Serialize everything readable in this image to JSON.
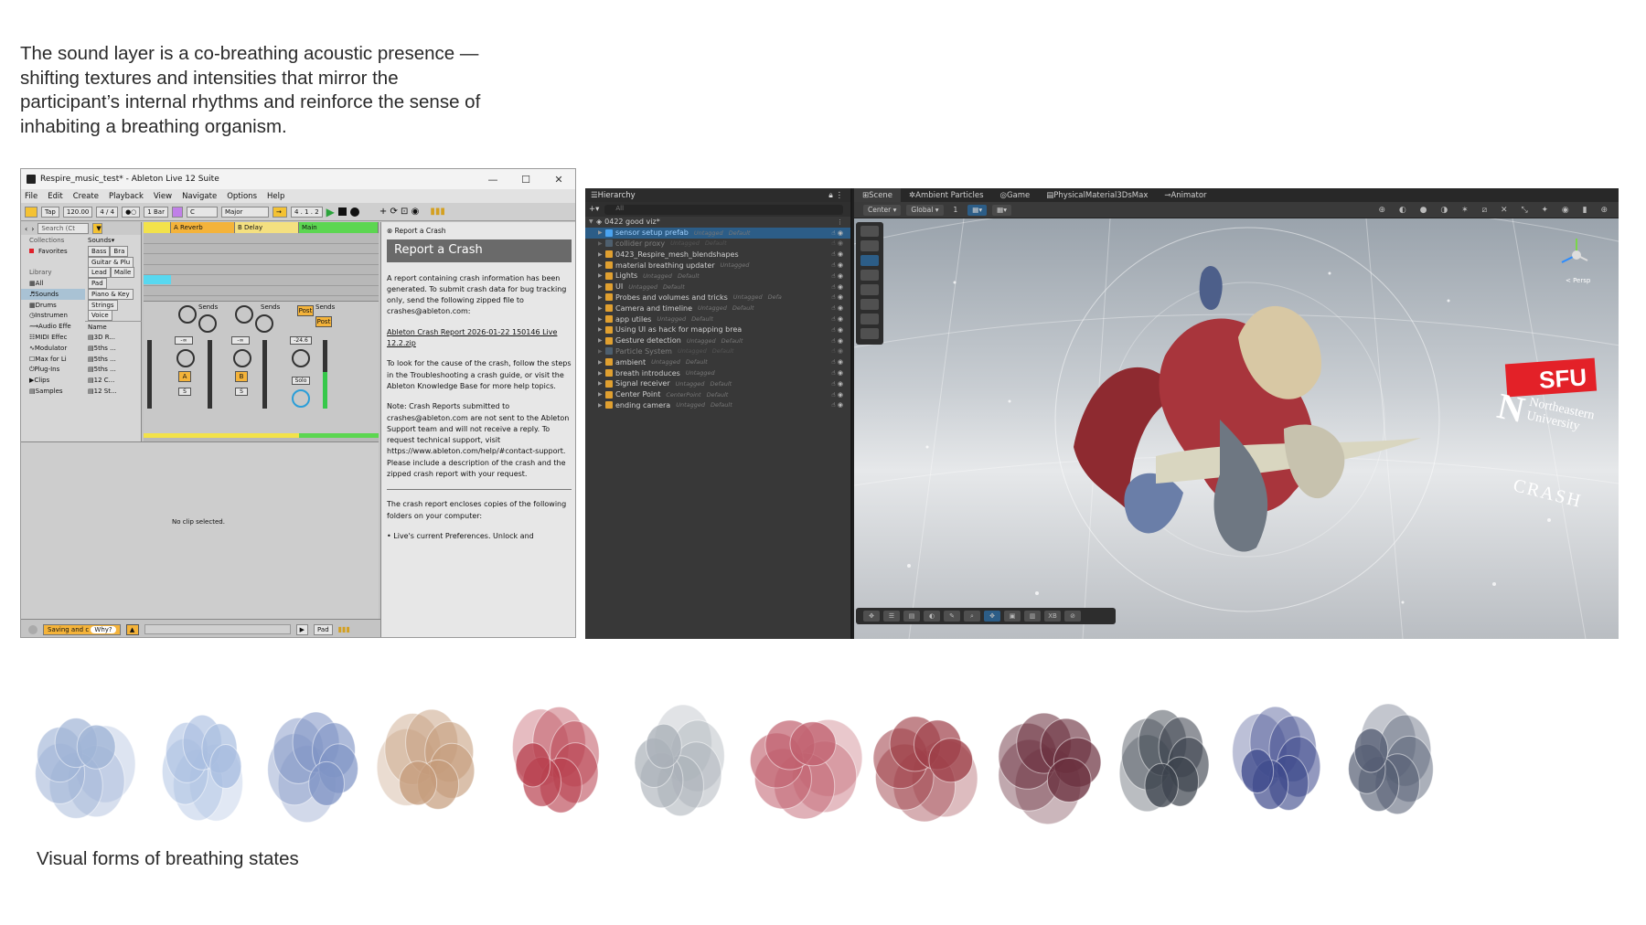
{
  "intro_text": "The sound layer is a co-breathing acoustic presence — shifting textures and intensities that mirror the participant’s internal rhythms and reinforce the sense of inhabiting a breathing organism.",
  "caption": "Visual forms of breathing states",
  "ableton": {
    "window_title": "Respire_music_test* - Ableton Live 12 Suite",
    "menu": [
      "File",
      "Edit",
      "Create",
      "Playback",
      "View",
      "Navigate",
      "Options",
      "Help"
    ],
    "transport": {
      "tap": "Tap",
      "bpm": "120.00",
      "meter": "4 / 4",
      "quantize": "1 Bar",
      "key": "C",
      "scale": "Major",
      "position": "4 . 1 . 2"
    },
    "browser": {
      "search_placeholder": "Search (Ct",
      "collections_header": "Collections",
      "favorites": "Favorites",
      "library_header": "Library",
      "library_items": [
        "All",
        "Sounds",
        "Drums",
        "Instrumen",
        "Audio Effe",
        "MIDI Effec",
        "Modulator",
        "Max for Li",
        "Plug-Ins",
        "Clips",
        "Samples"
      ],
      "column_header": "Sounds",
      "categories": [
        "Bass",
        "Bra",
        "Guitar & Plu",
        "Lead",
        "Malle",
        "Pad",
        "Piano & Key",
        "Strings",
        "Voice"
      ],
      "name_header": "Name",
      "files": [
        "3D R...",
        "5ths ...",
        "5ths ...",
        "5ths ...",
        "12 C...",
        "12 St..."
      ]
    },
    "tracks": [
      "",
      "A Reverb",
      "B Delay",
      "Main"
    ],
    "mixer": {
      "sends_label": "Sends",
      "post_label": "Post",
      "solo_label": "Solo",
      "vol_a": "-∞",
      "vol_b": "-∞",
      "vol_main": "-24.6",
      "a_label": "A",
      "b_label": "B",
      "s_label": "S"
    },
    "no_clip": "No clip selected.",
    "crash": {
      "pane_title": "Report a Crash",
      "heading": "Report a Crash",
      "p1": "A report containing crash information has been generated. To submit crash data for bug tracking only, send the following zipped file to crashes@ableton.com:",
      "file": "Ableton Crash Report 2026-01-22 150146 Live 12.2.zip",
      "p2": "To look for the cause of the crash, follow the steps in the Troubleshooting a crash guide, or visit the Ableton Knowledge Base for more help topics.",
      "p3": "Note: Crash Reports submitted to crashes@ableton.com are not sent to the Ableton Support team and will not receive a reply. To request technical support, visit https://www.ableton.com/help/#contact-support. Please include a description of the crash and the zipped crash report with your request.",
      "p4": "The crash report encloses copies of the following folders on your computer:",
      "p5": "• Live's current Preferences. Unlock and"
    },
    "status": {
      "saving": "Saving and c",
      "why": "Why?",
      "pad": "Pad"
    }
  },
  "unity": {
    "hierarchy_tab": "Hierarchy",
    "search_placeholder": "All",
    "scene_root": "0422 good viz*",
    "objects": [
      {
        "name": "sensor setup prefab",
        "tag": "Untagged",
        "layer": "Default",
        "state": "selected"
      },
      {
        "name": "collider proxy",
        "tag": "Untagged",
        "layer": "Default",
        "state": "dim"
      },
      {
        "name": "0423_Respire_mesh_blendshapes",
        "tag": "",
        "layer": "",
        "state": "normal"
      },
      {
        "name": "material breathing updater",
        "tag": "Untagged",
        "layer": "",
        "state": "normal"
      },
      {
        "name": "Lights",
        "tag": "Untagged",
        "layer": "Default",
        "state": "normal"
      },
      {
        "name": "UI",
        "tag": "Untagged",
        "layer": "Default",
        "state": "normal"
      },
      {
        "name": "Probes and volumes and tricks",
        "tag": "Untagged",
        "layer": "Defa",
        "state": "normal"
      },
      {
        "name": "Camera and timeline",
        "tag": "Untagged",
        "layer": "Default",
        "state": "normal"
      },
      {
        "name": "app utiles",
        "tag": "Untagged",
        "layer": "Default",
        "state": "normal"
      },
      {
        "name": "Using UI as hack for mapping brea",
        "tag": "",
        "layer": "",
        "state": "normal"
      },
      {
        "name": "Gesture detection",
        "tag": "Untagged",
        "layer": "Default",
        "state": "normal"
      },
      {
        "name": "Particle System",
        "tag": "Untagged",
        "layer": "Default",
        "state": "dim"
      },
      {
        "name": "ambient",
        "tag": "Untagged",
        "layer": "Default",
        "state": "normal"
      },
      {
        "name": "breath introduces",
        "tag": "Untagged",
        "layer": "",
        "state": "normal"
      },
      {
        "name": "Signal receiver",
        "tag": "Untagged",
        "layer": "Default",
        "state": "normal"
      },
      {
        "name": "Center Point",
        "tag": "CenterPoint",
        "layer": "Default",
        "state": "normal"
      },
      {
        "name": "ending camera",
        "tag": "Untagged",
        "layer": "Default",
        "state": "normal"
      }
    ],
    "tabs": [
      "Scene",
      "Ambient Particles",
      "Game",
      "PhysicalMaterial3DsMax",
      "Animator"
    ],
    "toolbar": {
      "pivot": "Center",
      "space": "Global",
      "value": "1"
    },
    "persp": "< Persp",
    "bottom_label": "XB",
    "logos": {
      "sfu": "SFU",
      "neu_letter": "N",
      "neu_name": "Northeastern University",
      "crash": "CRASH"
    }
  },
  "forms_palette": [
    "#9fb3d6",
    "#a8bde0",
    "#7e93c4",
    "#c49b7a",
    "#b8404e",
    "#a9b0b8",
    "#c0606e",
    "#9e3f48",
    "#6a2f3d",
    "#3a414c",
    "#3e4a8c",
    "#545d72"
  ]
}
